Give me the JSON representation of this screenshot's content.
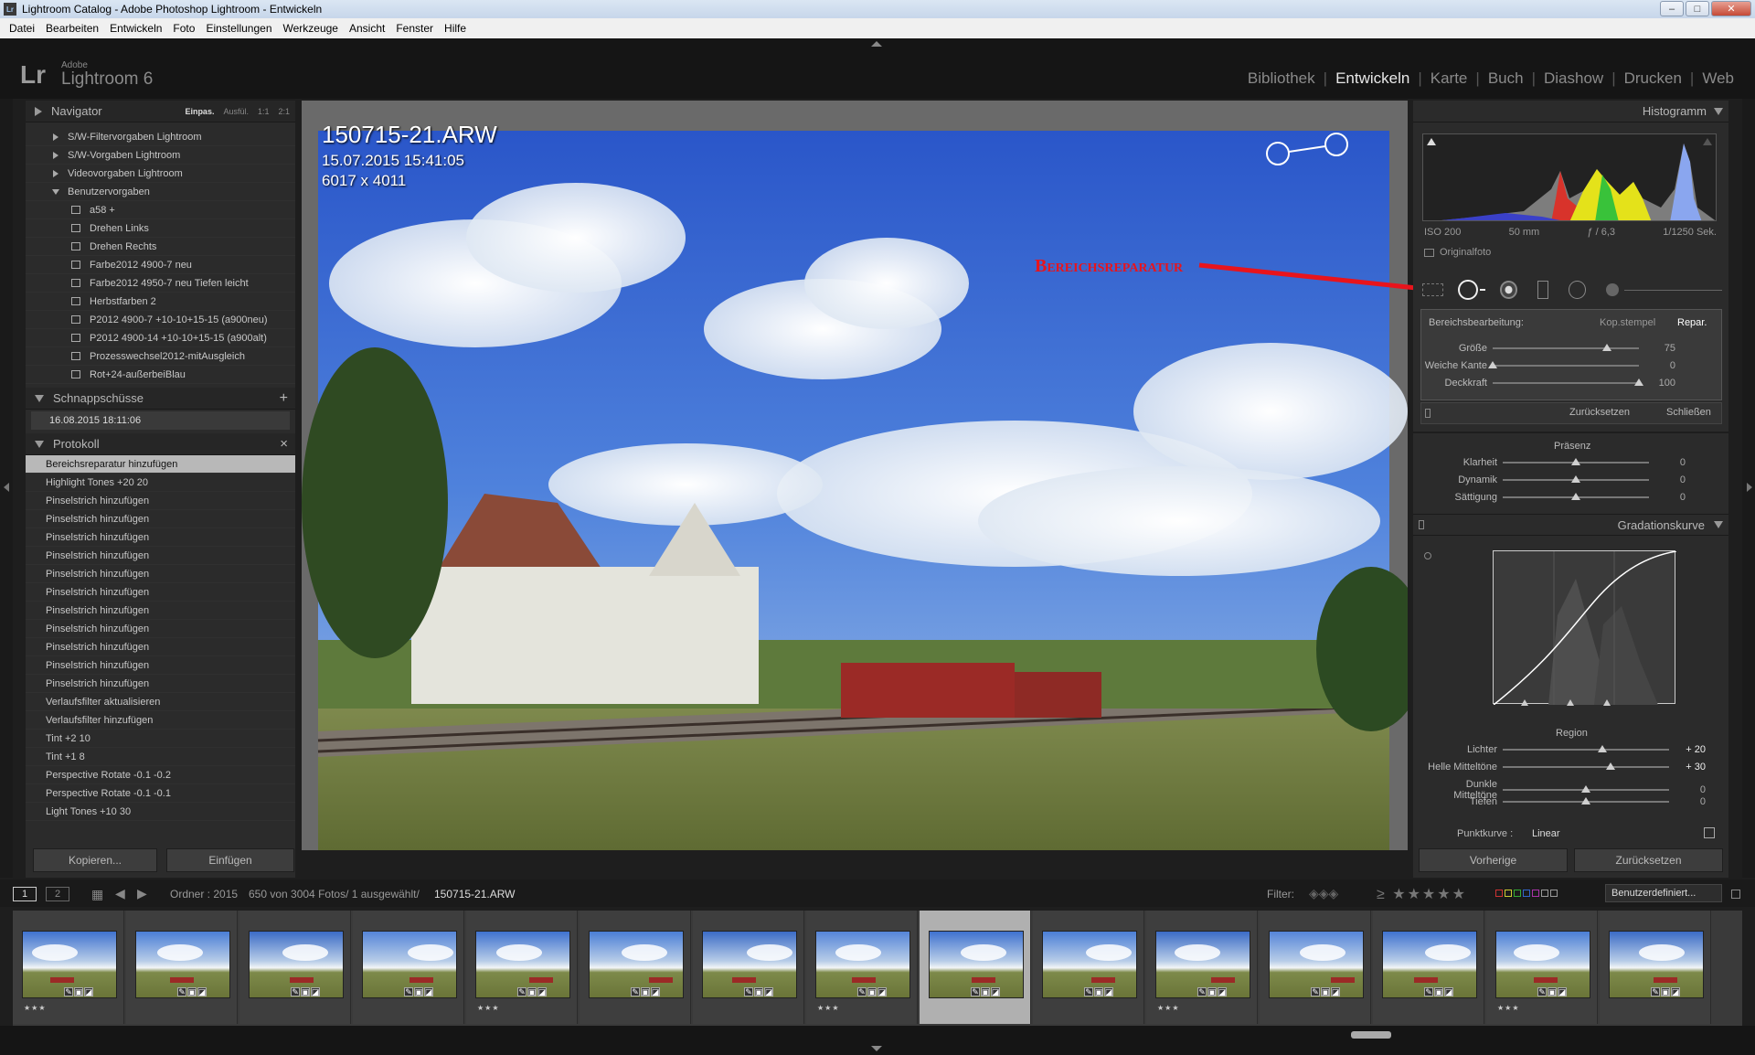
{
  "window": {
    "title": "Lightroom Catalog - Adobe Photoshop Lightroom - Entwickeln"
  },
  "menu": [
    "Datei",
    "Bearbeiten",
    "Entwickeln",
    "Foto",
    "Einstellungen",
    "Werkzeuge",
    "Ansicht",
    "Fenster",
    "Hilfe"
  ],
  "brand": {
    "lr": "Lr",
    "adobe": "Adobe",
    "name": "Lightroom 6"
  },
  "modules": [
    "Bibliothek",
    "Entwickeln",
    "Karte",
    "Buch",
    "Diashow",
    "Drucken",
    "Web"
  ],
  "active_module": "Entwickeln",
  "navigator": {
    "title": "Navigator",
    "opts": [
      "Einpas.",
      "Ausfül.",
      "1:1",
      "2:1"
    ]
  },
  "presets": {
    "folders": [
      "S/W-Filtervorgaben Lightroom",
      "S/W-Vorgaben Lightroom",
      "Videovorgaben Lightroom",
      "Benutzervorgaben"
    ],
    "items": [
      "a58 +",
      "Drehen Links",
      "Drehen Rechts",
      "Farbe2012 4900-7 neu",
      "Farbe2012 4950-7 neu Tiefen leicht",
      "Herbstfarben 2",
      "P2012 4900-7 +10-10+15-15 (a900neu)",
      "P2012 4900-14 +10-10+15-15 (a900alt)",
      "Prozesswechsel2012-mitAusgleich",
      "Rot+24-außerbeiBlau"
    ]
  },
  "snapshots": {
    "title": "Schnappschüsse",
    "add": "+",
    "items": [
      "16.08.2015 18:11:06"
    ]
  },
  "history": {
    "title": "Protokoll",
    "clear": "×",
    "items": [
      "Bereichsreparatur hinzufügen",
      "Highlight Tones  +20  20",
      "Pinselstrich hinzufügen",
      "Pinselstrich hinzufügen",
      "Pinselstrich hinzufügen",
      "Pinselstrich hinzufügen",
      "Pinselstrich hinzufügen",
      "Pinselstrich hinzufügen",
      "Pinselstrich hinzufügen",
      "Pinselstrich hinzufügen",
      "Pinselstrich hinzufügen",
      "Pinselstrich hinzufügen",
      "Pinselstrich hinzufügen",
      "Verlaufsfilter aktualisieren",
      "Verlaufsfilter hinzufügen",
      "Tint  +2  10",
      "Tint  +1  8",
      "Perspective Rotate  -0.1  -0.2",
      "Perspective Rotate  -0.1  -0.1",
      "Light Tones  +10  30"
    ]
  },
  "left_buttons": {
    "copy": "Kopieren...",
    "paste": "Einfügen"
  },
  "photo": {
    "filename": "150715-21.ARW",
    "datetime": "15.07.2015 15:41:05",
    "dimensions": "6017 x 4011"
  },
  "annotation": "Bereichsreparatur",
  "histogram": {
    "title": "Histogramm",
    "iso": "ISO 200",
    "focal": "50 mm",
    "aperture": "ƒ / 6,3",
    "shutter": "1/1250 Sek.",
    "original": "Originalfoto"
  },
  "spot": {
    "label": "Bereichsbearbeitung:",
    "mode_clone": "Kop.stempel",
    "mode_heal": "Repar.",
    "sliders": [
      {
        "label": "Größe",
        "value": "75",
        "pos": 0.78
      },
      {
        "label": "Weiche Kante",
        "value": "0",
        "pos": 0.0
      },
      {
        "label": "Deckkraft",
        "value": "100",
        "pos": 1.0
      }
    ],
    "reset": "Zurücksetzen",
    "close": "Schließen"
  },
  "presence": {
    "title": "Präsenz",
    "sliders": [
      {
        "label": "Klarheit",
        "value": "0",
        "pos": 0.5
      },
      {
        "label": "Dynamik",
        "value": "0",
        "pos": 0.5
      },
      {
        "label": "Sättigung",
        "value": "0",
        "pos": 0.5
      }
    ]
  },
  "tone_curve": {
    "title": "Gradationskurve",
    "region": "Region",
    "sliders": [
      {
        "label": "Lichter",
        "value": "+ 20",
        "pos": 0.6,
        "bright": true
      },
      {
        "label": "Helle Mitteltöne",
        "value": "+ 30",
        "pos": 0.65,
        "bright": true
      },
      {
        "label": "Dunkle Mitteltöne",
        "value": "0",
        "pos": 0.5
      },
      {
        "label": "Tiefen",
        "value": "0",
        "pos": 0.5
      }
    ],
    "point_curve_label": "Punktkurve :",
    "point_curve_value": "Linear"
  },
  "right_buttons": {
    "previous": "Vorherige",
    "reset": "Zurücksetzen"
  },
  "filmstrip_bar": {
    "page1": "1",
    "page2": "2",
    "source": "Ordner : 2015",
    "count": "650 von 3004 Fotos/ 1 ausgewählt/",
    "current": "150715-21.ARW",
    "filter_label": "Filter:",
    "filter_preset": "Benutzerdefiniert..."
  },
  "thumbs": [
    {
      "stars": "★★★",
      "sel": false
    },
    {
      "stars": "",
      "sel": false
    },
    {
      "stars": "",
      "sel": false
    },
    {
      "stars": "",
      "sel": false
    },
    {
      "stars": "★★★",
      "sel": false
    },
    {
      "stars": "",
      "sel": false
    },
    {
      "stars": "",
      "sel": false
    },
    {
      "stars": "★★★",
      "sel": false
    },
    {
      "stars": "",
      "sel": true
    },
    {
      "stars": "",
      "sel": false
    },
    {
      "stars": "★★★",
      "sel": false
    },
    {
      "stars": "",
      "sel": false
    },
    {
      "stars": "",
      "sel": false
    },
    {
      "stars": "★★★",
      "sel": false
    },
    {
      "stars": "",
      "sel": false
    }
  ],
  "colors": {
    "accent_arrow": "#e8141c",
    "selected_cell": "#b0b0b0",
    "panel_bg": "#2b2b2b"
  }
}
